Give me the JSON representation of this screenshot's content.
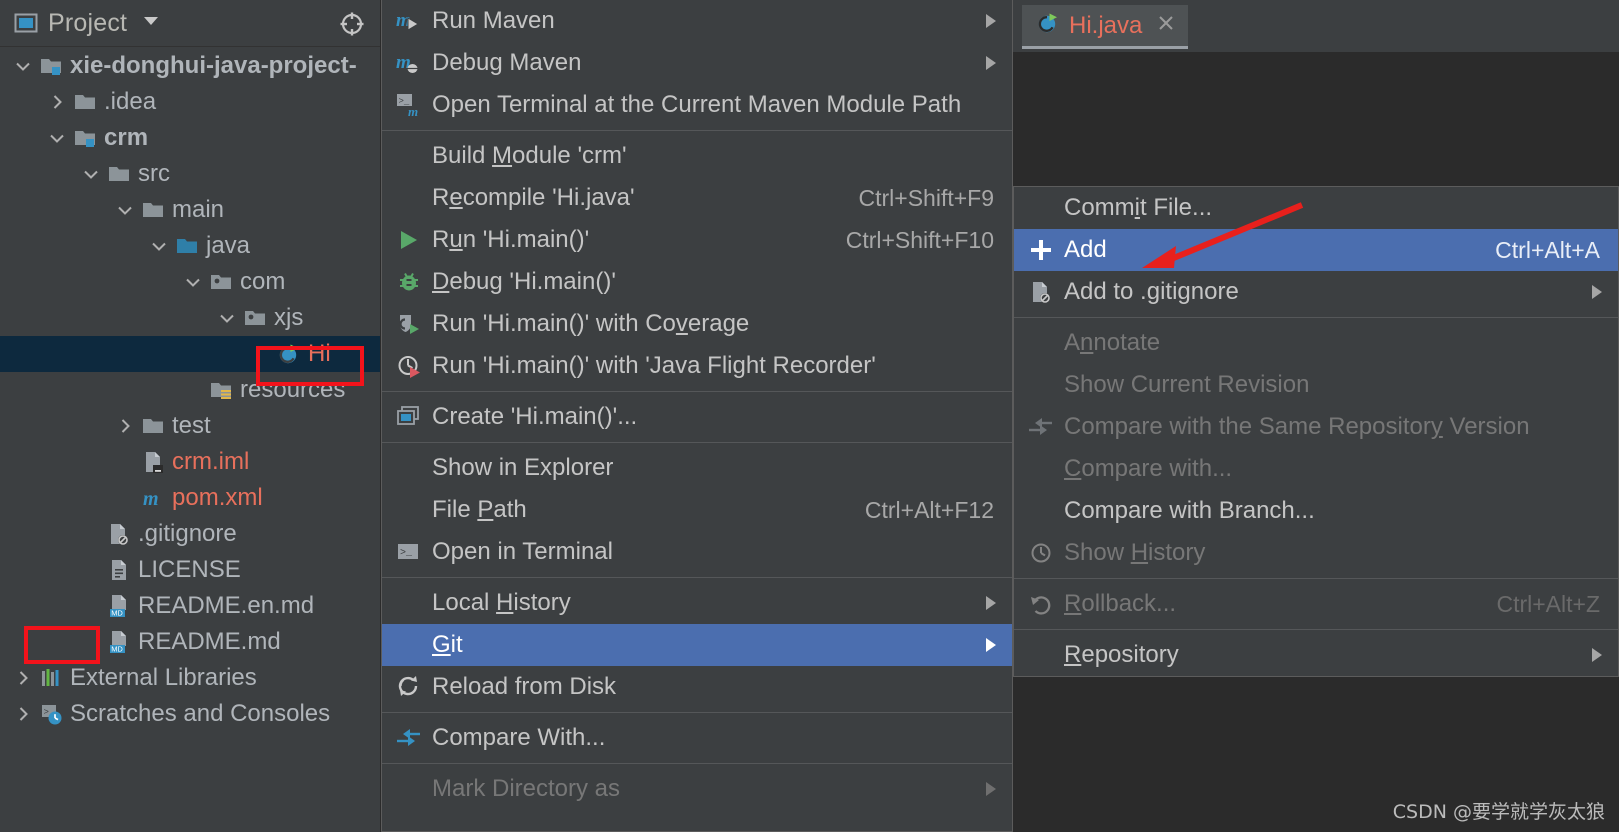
{
  "panel": {
    "title": "Project",
    "icon": "project-window-icon",
    "caret_icon": "chevron-down-icon",
    "locate_icon": "locate-target-icon"
  },
  "tree": {
    "items": [
      {
        "label": "xie-donghui-java-project-",
        "icon": "module-folder-icon",
        "indent": 0,
        "twisty": "expanded",
        "bold": true,
        "color": "grey",
        "selected": false
      },
      {
        "label": ".idea",
        "icon": "folder-icon",
        "indent": 1,
        "twisty": "collapsed",
        "bold": false,
        "color": "grey",
        "selected": false
      },
      {
        "label": "crm",
        "icon": "module-folder-icon",
        "indent": 1,
        "twisty": "expanded",
        "bold": true,
        "color": "grey",
        "selected": false
      },
      {
        "label": "src",
        "icon": "folder-icon",
        "indent": 2,
        "twisty": "expanded",
        "bold": false,
        "color": "grey",
        "selected": false
      },
      {
        "label": "main",
        "icon": "folder-icon",
        "indent": 3,
        "twisty": "expanded",
        "bold": false,
        "color": "grey",
        "selected": false
      },
      {
        "label": "java",
        "icon": "source-folder-icon",
        "indent": 4,
        "twisty": "expanded",
        "bold": false,
        "color": "grey",
        "selected": false
      },
      {
        "label": "com",
        "icon": "package-icon",
        "indent": 5,
        "twisty": "expanded",
        "bold": false,
        "color": "grey",
        "selected": false
      },
      {
        "label": "xjs",
        "icon": "package-icon",
        "indent": 6,
        "twisty": "expanded",
        "bold": false,
        "color": "grey",
        "selected": false
      },
      {
        "label": "Hi",
        "icon": "java-run-class-icon",
        "indent": 7,
        "twisty": "none",
        "bold": false,
        "color": "red",
        "selected": true
      },
      {
        "label": "resources",
        "icon": "resource-folder-icon",
        "indent": 5,
        "twisty": "none",
        "bold": false,
        "color": "grey",
        "selected": false
      },
      {
        "label": "test",
        "icon": "folder-icon",
        "indent": 3,
        "twisty": "collapsed",
        "bold": false,
        "color": "grey",
        "selected": false
      },
      {
        "label": "crm.iml",
        "icon": "iml-file-icon",
        "indent": 3,
        "twisty": "none",
        "bold": false,
        "color": "red",
        "selected": false
      },
      {
        "label": "pom.xml",
        "icon": "maven-file-icon",
        "indent": 3,
        "twisty": "none",
        "bold": false,
        "color": "red",
        "selected": false
      },
      {
        "label": ".gitignore",
        "icon": "gitignore-file-icon",
        "indent": 2,
        "twisty": "none",
        "bold": false,
        "color": "grey",
        "selected": false
      },
      {
        "label": "LICENSE",
        "icon": "text-file-icon",
        "indent": 2,
        "twisty": "none",
        "bold": false,
        "color": "grey",
        "selected": false
      },
      {
        "label": "README.en.md",
        "icon": "markdown-file-icon",
        "indent": 2,
        "twisty": "none",
        "bold": false,
        "color": "grey",
        "selected": false
      },
      {
        "label": "README.md",
        "icon": "markdown-file-icon",
        "indent": 2,
        "twisty": "none",
        "bold": false,
        "color": "grey",
        "selected": false
      },
      {
        "label": "External Libraries",
        "icon": "libraries-icon",
        "indent": 0,
        "twisty": "collapsed",
        "bold": false,
        "color": "grey",
        "selected": false
      },
      {
        "label": "Scratches and Consoles",
        "icon": "scratches-icon",
        "indent": 0,
        "twisty": "collapsed",
        "bold": false,
        "color": "grey",
        "selected": false
      }
    ]
  },
  "context_menu": {
    "items": [
      {
        "type": "item",
        "label": "Run Maven",
        "icon": "maven-run-icon",
        "accel": "",
        "arrow": true,
        "disabled": false,
        "highlight": false,
        "mnemonic": ""
      },
      {
        "type": "item",
        "label": "Debug Maven",
        "icon": "maven-debug-icon",
        "accel": "",
        "arrow": true,
        "disabled": false,
        "highlight": false,
        "mnemonic": ""
      },
      {
        "type": "item",
        "label": "Open Terminal at the Current Maven Module Path",
        "icon": "terminal-maven-icon",
        "accel": "",
        "arrow": false,
        "disabled": false,
        "highlight": false,
        "mnemonic": ""
      },
      {
        "type": "separator"
      },
      {
        "type": "item",
        "label": "Build Module 'crm'",
        "icon": "",
        "accel": "",
        "arrow": false,
        "disabled": false,
        "highlight": false,
        "mnemonic": "M"
      },
      {
        "type": "item",
        "label": "Recompile 'Hi.java'",
        "icon": "",
        "accel": "Ctrl+Shift+F9",
        "arrow": false,
        "disabled": false,
        "highlight": false,
        "mnemonic": "e"
      },
      {
        "type": "item",
        "label": "Run 'Hi.main()'",
        "icon": "run-green-icon",
        "accel": "Ctrl+Shift+F10",
        "arrow": false,
        "disabled": false,
        "highlight": false,
        "mnemonic": "u"
      },
      {
        "type": "item",
        "label": "Debug 'Hi.main()'",
        "icon": "debug-bug-icon",
        "accel": "",
        "arrow": false,
        "disabled": false,
        "highlight": false,
        "mnemonic": "D"
      },
      {
        "type": "item",
        "label": "Run 'Hi.main()' with Coverage",
        "icon": "coverage-icon",
        "accel": "",
        "arrow": false,
        "disabled": false,
        "highlight": false,
        "mnemonic": "v"
      },
      {
        "type": "item",
        "label": "Run 'Hi.main()' with 'Java Flight Recorder'",
        "icon": "flight-recorder-icon",
        "accel": "",
        "arrow": false,
        "disabled": false,
        "highlight": false,
        "mnemonic": ""
      },
      {
        "type": "separator"
      },
      {
        "type": "item",
        "label": "Create 'Hi.main()'...",
        "icon": "create-config-icon",
        "accel": "",
        "arrow": false,
        "disabled": false,
        "highlight": false,
        "mnemonic": ""
      },
      {
        "type": "separator"
      },
      {
        "type": "item",
        "label": "Show in Explorer",
        "icon": "",
        "accel": "",
        "arrow": false,
        "disabled": false,
        "highlight": false,
        "mnemonic": ""
      },
      {
        "type": "item",
        "label": "File Path",
        "icon": "",
        "accel": "Ctrl+Alt+F12",
        "arrow": false,
        "disabled": false,
        "highlight": false,
        "mnemonic": "P"
      },
      {
        "type": "item",
        "label": "Open in Terminal",
        "icon": "terminal-icon",
        "accel": "",
        "arrow": false,
        "disabled": false,
        "highlight": false,
        "mnemonic": ""
      },
      {
        "type": "separator"
      },
      {
        "type": "item",
        "label": "Local History",
        "icon": "",
        "accel": "",
        "arrow": true,
        "disabled": false,
        "highlight": false,
        "mnemonic": "H"
      },
      {
        "type": "item",
        "label": "Git",
        "icon": "",
        "accel": "",
        "arrow": true,
        "disabled": false,
        "highlight": true,
        "mnemonic": "G"
      },
      {
        "type": "item",
        "label": "Reload from Disk",
        "icon": "reload-icon",
        "accel": "",
        "arrow": false,
        "disabled": false,
        "highlight": false,
        "mnemonic": ""
      },
      {
        "type": "separator"
      },
      {
        "type": "item",
        "label": "Compare With...",
        "icon": "compare-icon",
        "accel": "",
        "arrow": false,
        "disabled": false,
        "highlight": false,
        "mnemonic": ""
      },
      {
        "type": "separator"
      },
      {
        "type": "item",
        "label": "Mark Directory as",
        "icon": "",
        "accel": "",
        "arrow": true,
        "disabled": true,
        "highlight": false,
        "mnemonic": ""
      }
    ]
  },
  "git_submenu": {
    "items": [
      {
        "type": "item",
        "label": "Commit File...",
        "icon": "",
        "accel": "",
        "arrow": false,
        "disabled": false,
        "highlight": false,
        "mnemonic": "i"
      },
      {
        "type": "item",
        "label": "Add",
        "icon": "plus-icon",
        "accel": "Ctrl+Alt+A",
        "arrow": false,
        "disabled": false,
        "highlight": true,
        "mnemonic": ""
      },
      {
        "type": "item",
        "label": "Add to .gitignore",
        "icon": "gitignore-file-icon",
        "accel": "",
        "arrow": true,
        "disabled": false,
        "highlight": false,
        "mnemonic": ""
      },
      {
        "type": "separator"
      },
      {
        "type": "item",
        "label": "Annotate",
        "icon": "",
        "accel": "",
        "arrow": false,
        "disabled": true,
        "highlight": false,
        "mnemonic": "n"
      },
      {
        "type": "item",
        "label": "Show Current Revision",
        "icon": "",
        "accel": "",
        "arrow": false,
        "disabled": true,
        "highlight": false,
        "mnemonic": ""
      },
      {
        "type": "item",
        "label": "Compare with the Same Repository Version",
        "icon": "compare-icon-dim",
        "accel": "",
        "arrow": false,
        "disabled": true,
        "highlight": false,
        "mnemonic": "y"
      },
      {
        "type": "item",
        "label": "Compare with...",
        "icon": "",
        "accel": "",
        "arrow": false,
        "disabled": true,
        "highlight": false,
        "mnemonic": "C"
      },
      {
        "type": "item",
        "label": "Compare with Branch...",
        "icon": "",
        "accel": "",
        "arrow": false,
        "disabled": false,
        "highlight": false,
        "mnemonic": ""
      },
      {
        "type": "item",
        "label": "Show History",
        "icon": "history-clock-icon",
        "accel": "",
        "arrow": false,
        "disabled": true,
        "highlight": false,
        "mnemonic": "H"
      },
      {
        "type": "separator"
      },
      {
        "type": "item",
        "label": "Rollback...",
        "icon": "rollback-icon",
        "accel": "Ctrl+Alt+Z",
        "arrow": false,
        "disabled": true,
        "highlight": false,
        "mnemonic": "R"
      },
      {
        "type": "separator"
      },
      {
        "type": "item",
        "label": "Repository",
        "icon": "",
        "accel": "",
        "arrow": true,
        "disabled": false,
        "highlight": false,
        "mnemonic": "R"
      }
    ]
  },
  "editor": {
    "tab": {
      "label": "Hi.java",
      "icon": "java-run-class-icon",
      "close_icon": "close-icon"
    }
  },
  "annotations": {
    "hi_box_color": "#f3131b",
    "git_box_color": "#f3131b",
    "arrow_color": "#e8201c",
    "highlight_color": "#4b6eaf",
    "selection_color": "#0d293e"
  },
  "watermark": {
    "text": "CSDN @要学就学灰太狼"
  }
}
